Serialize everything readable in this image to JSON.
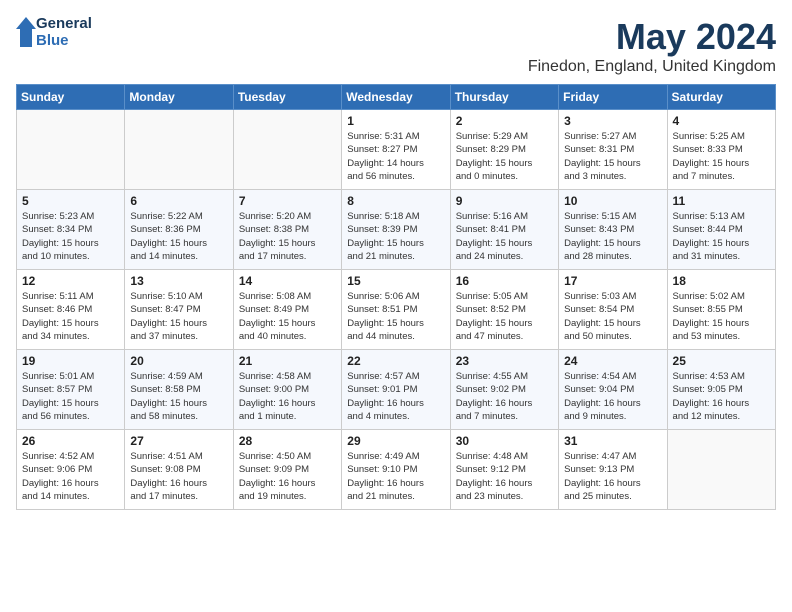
{
  "header": {
    "logo_line1": "General",
    "logo_line2": "Blue",
    "month": "May 2024",
    "location": "Finedon, England, United Kingdom"
  },
  "weekdays": [
    "Sunday",
    "Monday",
    "Tuesday",
    "Wednesday",
    "Thursday",
    "Friday",
    "Saturday"
  ],
  "weeks": [
    [
      {
        "day": "",
        "info": ""
      },
      {
        "day": "",
        "info": ""
      },
      {
        "day": "",
        "info": ""
      },
      {
        "day": "1",
        "info": "Sunrise: 5:31 AM\nSunset: 8:27 PM\nDaylight: 14 hours\nand 56 minutes."
      },
      {
        "day": "2",
        "info": "Sunrise: 5:29 AM\nSunset: 8:29 PM\nDaylight: 15 hours\nand 0 minutes."
      },
      {
        "day": "3",
        "info": "Sunrise: 5:27 AM\nSunset: 8:31 PM\nDaylight: 15 hours\nand 3 minutes."
      },
      {
        "day": "4",
        "info": "Sunrise: 5:25 AM\nSunset: 8:33 PM\nDaylight: 15 hours\nand 7 minutes."
      }
    ],
    [
      {
        "day": "5",
        "info": "Sunrise: 5:23 AM\nSunset: 8:34 PM\nDaylight: 15 hours\nand 10 minutes."
      },
      {
        "day": "6",
        "info": "Sunrise: 5:22 AM\nSunset: 8:36 PM\nDaylight: 15 hours\nand 14 minutes."
      },
      {
        "day": "7",
        "info": "Sunrise: 5:20 AM\nSunset: 8:38 PM\nDaylight: 15 hours\nand 17 minutes."
      },
      {
        "day": "8",
        "info": "Sunrise: 5:18 AM\nSunset: 8:39 PM\nDaylight: 15 hours\nand 21 minutes."
      },
      {
        "day": "9",
        "info": "Sunrise: 5:16 AM\nSunset: 8:41 PM\nDaylight: 15 hours\nand 24 minutes."
      },
      {
        "day": "10",
        "info": "Sunrise: 5:15 AM\nSunset: 8:43 PM\nDaylight: 15 hours\nand 28 minutes."
      },
      {
        "day": "11",
        "info": "Sunrise: 5:13 AM\nSunset: 8:44 PM\nDaylight: 15 hours\nand 31 minutes."
      }
    ],
    [
      {
        "day": "12",
        "info": "Sunrise: 5:11 AM\nSunset: 8:46 PM\nDaylight: 15 hours\nand 34 minutes."
      },
      {
        "day": "13",
        "info": "Sunrise: 5:10 AM\nSunset: 8:47 PM\nDaylight: 15 hours\nand 37 minutes."
      },
      {
        "day": "14",
        "info": "Sunrise: 5:08 AM\nSunset: 8:49 PM\nDaylight: 15 hours\nand 40 minutes."
      },
      {
        "day": "15",
        "info": "Sunrise: 5:06 AM\nSunset: 8:51 PM\nDaylight: 15 hours\nand 44 minutes."
      },
      {
        "day": "16",
        "info": "Sunrise: 5:05 AM\nSunset: 8:52 PM\nDaylight: 15 hours\nand 47 minutes."
      },
      {
        "day": "17",
        "info": "Sunrise: 5:03 AM\nSunset: 8:54 PM\nDaylight: 15 hours\nand 50 minutes."
      },
      {
        "day": "18",
        "info": "Sunrise: 5:02 AM\nSunset: 8:55 PM\nDaylight: 15 hours\nand 53 minutes."
      }
    ],
    [
      {
        "day": "19",
        "info": "Sunrise: 5:01 AM\nSunset: 8:57 PM\nDaylight: 15 hours\nand 56 minutes."
      },
      {
        "day": "20",
        "info": "Sunrise: 4:59 AM\nSunset: 8:58 PM\nDaylight: 15 hours\nand 58 minutes."
      },
      {
        "day": "21",
        "info": "Sunrise: 4:58 AM\nSunset: 9:00 PM\nDaylight: 16 hours\nand 1 minute."
      },
      {
        "day": "22",
        "info": "Sunrise: 4:57 AM\nSunset: 9:01 PM\nDaylight: 16 hours\nand 4 minutes."
      },
      {
        "day": "23",
        "info": "Sunrise: 4:55 AM\nSunset: 9:02 PM\nDaylight: 16 hours\nand 7 minutes."
      },
      {
        "day": "24",
        "info": "Sunrise: 4:54 AM\nSunset: 9:04 PM\nDaylight: 16 hours\nand 9 minutes."
      },
      {
        "day": "25",
        "info": "Sunrise: 4:53 AM\nSunset: 9:05 PM\nDaylight: 16 hours\nand 12 minutes."
      }
    ],
    [
      {
        "day": "26",
        "info": "Sunrise: 4:52 AM\nSunset: 9:06 PM\nDaylight: 16 hours\nand 14 minutes."
      },
      {
        "day": "27",
        "info": "Sunrise: 4:51 AM\nSunset: 9:08 PM\nDaylight: 16 hours\nand 17 minutes."
      },
      {
        "day": "28",
        "info": "Sunrise: 4:50 AM\nSunset: 9:09 PM\nDaylight: 16 hours\nand 19 minutes."
      },
      {
        "day": "29",
        "info": "Sunrise: 4:49 AM\nSunset: 9:10 PM\nDaylight: 16 hours\nand 21 minutes."
      },
      {
        "day": "30",
        "info": "Sunrise: 4:48 AM\nSunset: 9:12 PM\nDaylight: 16 hours\nand 23 minutes."
      },
      {
        "day": "31",
        "info": "Sunrise: 4:47 AM\nSunset: 9:13 PM\nDaylight: 16 hours\nand 25 minutes."
      },
      {
        "day": "",
        "info": ""
      }
    ]
  ]
}
